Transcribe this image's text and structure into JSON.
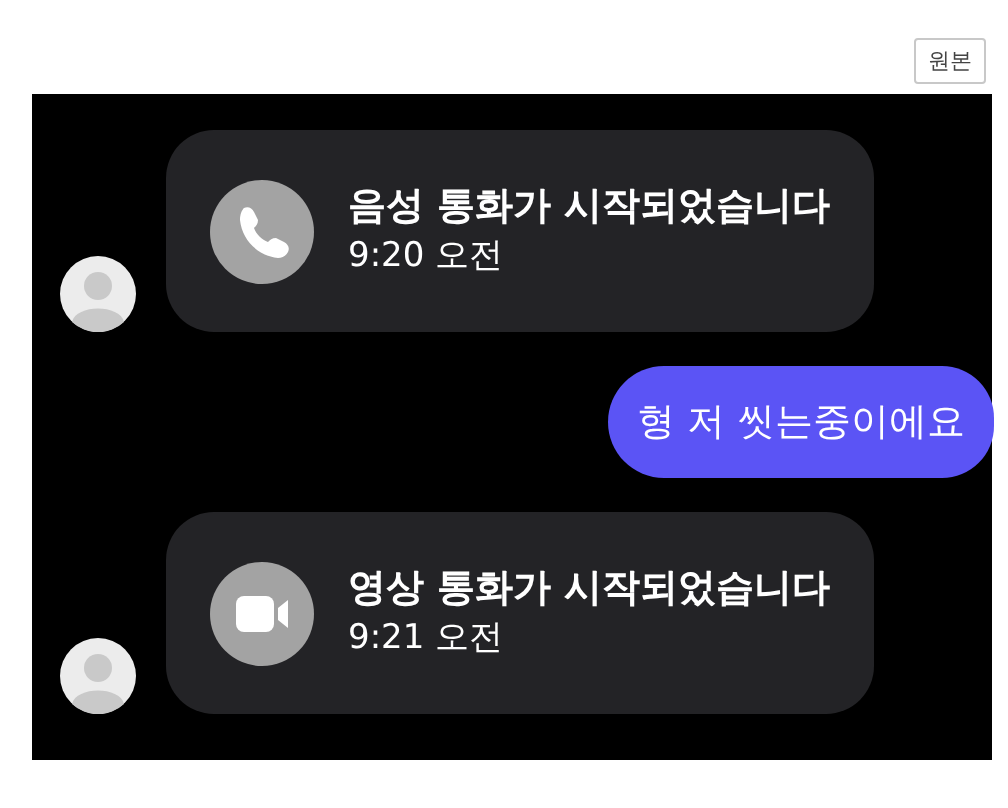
{
  "toolbar": {
    "original_button": "원본"
  },
  "messages": [
    {
      "kind": "voice",
      "title": "음성 통화가 시작되었습니다",
      "time": "9:20 오전"
    },
    {
      "kind": "text",
      "text": "형 저 씻는중이에요"
    },
    {
      "kind": "video",
      "title": "영상 통화가 시작되었습니다",
      "time": "9:21 오전"
    }
  ]
}
